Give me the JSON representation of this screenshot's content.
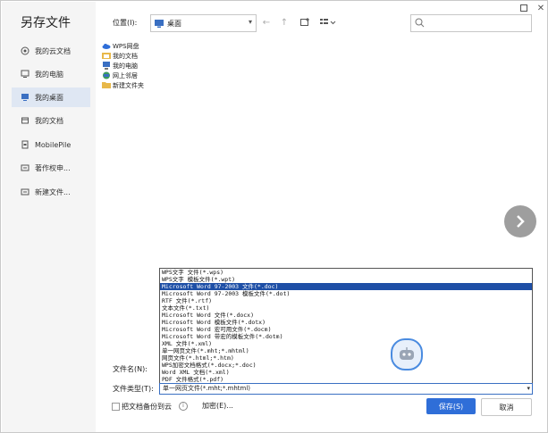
{
  "dialog": {
    "title": "另存文件"
  },
  "sidebar": {
    "items": [
      {
        "label": "我的云文档",
        "icon": "cloud-doc-icon"
      },
      {
        "label": "我的电脑",
        "icon": "computer-icon"
      },
      {
        "label": "我的桌面",
        "icon": "desktop-icon",
        "active": true
      },
      {
        "label": "我的文档",
        "icon": "document-icon"
      },
      {
        "label": "MobilePile",
        "icon": "mobile-icon"
      },
      {
        "label": "著作权申...",
        "icon": "folder-icon"
      },
      {
        "label": "新建文件...",
        "icon": "folder-icon"
      }
    ]
  },
  "toolbar": {
    "location_label": "位置(I):",
    "location_value": "桌面"
  },
  "files": [
    {
      "label": "WPS网盘",
      "icon": "cloud-icon"
    },
    {
      "label": "我的文档",
      "icon": "folder-icon"
    },
    {
      "label": "我的电脑",
      "icon": "computer-icon"
    },
    {
      "label": "网上邻居",
      "icon": "network-icon"
    },
    {
      "label": "新建文件夹",
      "icon": "folder-icon"
    }
  ],
  "file_types": [
    "WPS文字 文件(*.wps)",
    "WPS文字 模板文件(*.wpt)",
    "Microsoft Word 97-2003 文件(*.doc)",
    "Microsoft Word 97-2003 模板文件(*.dot)",
    "RTF 文件(*.rtf)",
    "文本文件(*.txt)",
    "Microsoft Word 文件(*.docx)",
    "Microsoft Word 模板文件(*.dotx)",
    "Microsoft Word 宏可用文件(*.docm)",
    "Microsoft Word 带宏的模板文件(*.dotm)",
    "XML 文件(*.xml)",
    "单一网页文件(*.mht;*.mhtml)",
    "网页文件(*.html;*.htm)",
    "WPS加密文档格式(*.docx;*.doc)",
    "Word XML 文档(*.xml)",
    "PDF 文件格式(*.pdf)"
  ],
  "selected_file_type_index": 2,
  "bottom": {
    "filename_label": "文件名(N):",
    "filetype_label": "文件类型(T):",
    "filetype_value": "单一网页文件(*.mht;*.mhtml)",
    "backup_label": "把文档备份到云",
    "encrypt_label": "加密(E)...",
    "save_label": "保存(S)",
    "cancel_label": "取消"
  },
  "colors": {
    "accent": "#2f6ed8",
    "selection": "#1e4fa6",
    "sidebar_bg": "#f5f5f5",
    "sidebar_active": "#dfe7f3"
  }
}
